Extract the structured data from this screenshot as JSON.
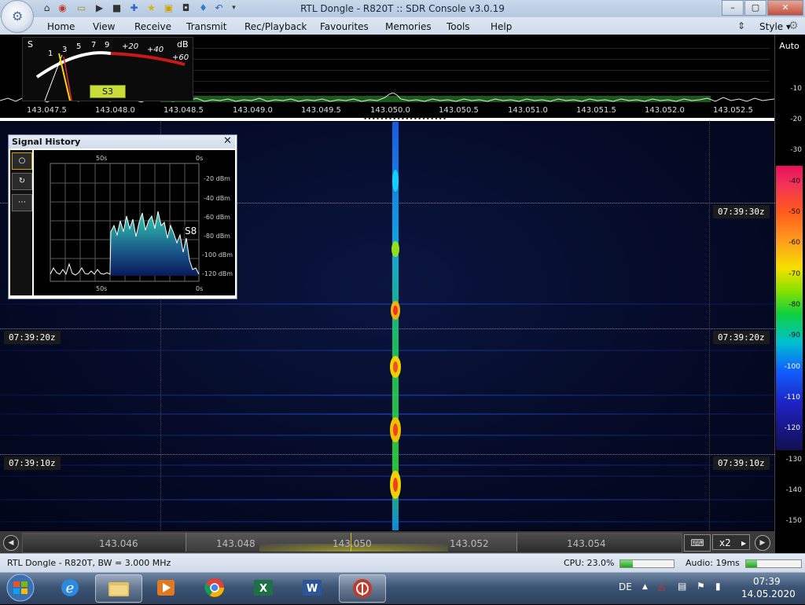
{
  "window": {
    "title": "RTL Dongle - R820T :: SDR Console v3.0.19",
    "buttons": {
      "minimize": "–",
      "maximize": "▢",
      "close": "✕"
    }
  },
  "quick_access": [
    "home-icon",
    "lifebuoy-icon",
    "folder-icon",
    "play-icon",
    "stop-icon",
    "plus-icon",
    "star-icon",
    "lock-icon",
    "camera-icon",
    "drop-icon",
    "undo-icon",
    "qat-dropdown-icon"
  ],
  "menu": {
    "items": [
      "Home",
      "View",
      "Receive",
      "Transmit",
      "Rec/Playback",
      "Favourites",
      "Memories",
      "Tools",
      "Help"
    ],
    "style": "Style"
  },
  "meter": {
    "s_label": "S",
    "db_label": "dB",
    "scale_s": [
      "1",
      "3",
      "5",
      "7",
      "9"
    ],
    "scale_plus": [
      "+20",
      "+40",
      "+60"
    ],
    "reading": "S3"
  },
  "spectrum": {
    "freq_labels": [
      "143.047.5",
      "143.048.0",
      "143.048.5",
      "143.049.0",
      "143.049.5",
      "143.050.0",
      "143.050.5",
      "143.051.0",
      "143.051.5",
      "143.052.0",
      "143.052.5"
    ]
  },
  "right_scale": {
    "auto": "Auto",
    "ticks": [
      "-10",
      "-20",
      "-30"
    ],
    "colorbar": [
      "-40",
      "-50",
      "-60",
      "-70",
      "-80",
      "-90",
      "-100",
      "-110",
      "-120"
    ],
    "lower_ticks": [
      "-130",
      "-140",
      "-150"
    ]
  },
  "waterfall": {
    "times": [
      "07:39:30z",
      "07:39:20z",
      "07:39:10z"
    ]
  },
  "signal_history": {
    "title": "Signal History",
    "close": "✕",
    "buttons": [
      "○",
      "↻",
      "⋯"
    ],
    "x_top": [
      "50s",
      "0s"
    ],
    "x_bottom": [
      "50s",
      "0s"
    ],
    "y_labels": [
      "-20 dBm",
      "-40 dBm",
      "-60 dBm",
      "-80 dBm",
      "-100 dBm",
      "-120 dBm"
    ],
    "current": "S8"
  },
  "scale_bar": {
    "labels": [
      "143.046",
      "143.048",
      "143.050",
      "143.052",
      "143.054"
    ],
    "zoom": "x2",
    "zoom_arrow": "▸",
    "left_btn": "◀",
    "right_btn": "▶",
    "keyboard": "⌨"
  },
  "status": {
    "device": "RTL Dongle - R820T, BW = 3.000 MHz",
    "cpu": "CPU: 23.0%",
    "cpu_level": 0.23,
    "audio": "Audio: 19ms",
    "audio_level": 0.2
  },
  "taskbar": {
    "apps": [
      "ie-icon",
      "explorer-icon",
      "media-player-icon",
      "chrome-icon",
      "excel-icon",
      "word-icon",
      "sdr-console-icon"
    ],
    "lang": "DE",
    "time": "07:39",
    "date": "14.05.2020"
  }
}
